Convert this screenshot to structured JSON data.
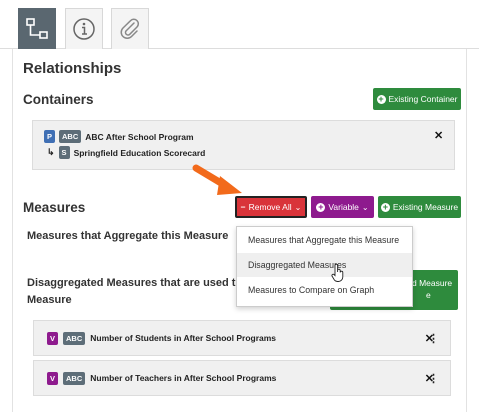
{
  "tabs": [
    {
      "icon": "sitemap-icon",
      "active": true
    },
    {
      "icon": "info-icon",
      "active": false
    },
    {
      "icon": "paperclip-icon",
      "active": false
    }
  ],
  "relationships_heading": "Relationships",
  "containers": {
    "heading": "Containers",
    "add_button": "Existing Container",
    "items": [
      {
        "badges": [
          "P",
          "ABC"
        ],
        "name": "ABC After School Program"
      },
      {
        "badges": [
          "S"
        ],
        "name": "Springfield Education Scorecard"
      }
    ]
  },
  "measures": {
    "heading": "Measures",
    "remove_button": "Remove All",
    "variable_button": "Variable",
    "existing_button": "Existing Measure",
    "aggregate_heading": "Measures that Aggregate this Measure",
    "disagg_heading_line1": "Disaggregated Measures that are used to",
    "disagg_heading_line2": "Measure",
    "hidden_button_fragment_1": "d Measure",
    "hidden_button_fragment_2": "e",
    "items": [
      {
        "badges": [
          "V",
          "ABC"
        ],
        "name": "Number of Students in After School Programs"
      },
      {
        "badges": [
          "V",
          "ABC"
        ],
        "name": "Number of Teachers in After School Programs"
      }
    ]
  },
  "dropdown": {
    "items": [
      "Measures that Aggregate this Measure",
      "Disaggregated Measures",
      "Measures to Compare on Graph"
    ],
    "hover_index": 1
  },
  "colors": {
    "green": "#2e8b3d",
    "red": "#d9343a",
    "purple": "#8e1a8e",
    "arrow": "#f26a1b"
  }
}
